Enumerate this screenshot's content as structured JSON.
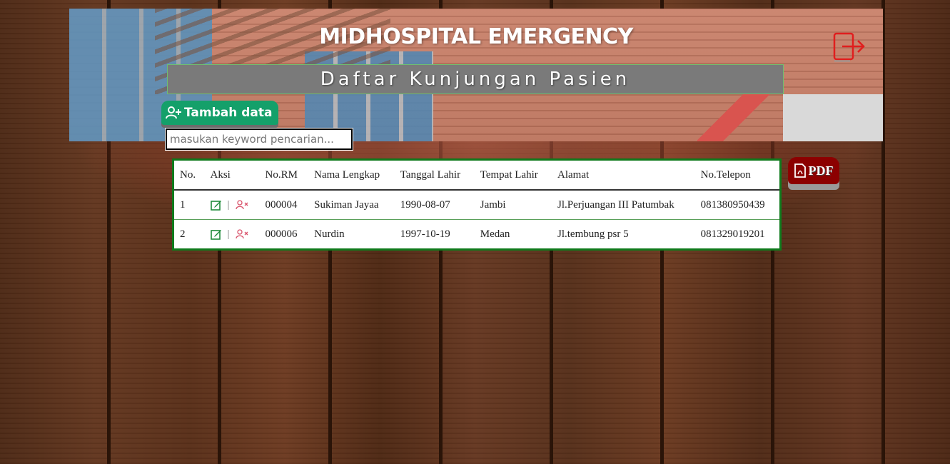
{
  "header": {
    "title": "MIDHOSPITAL EMERGENCY",
    "subtitle": "Daftar Kunjungan Pasien"
  },
  "actions": {
    "add_label": "Tambah data",
    "pdf_label": "PDF"
  },
  "search": {
    "placeholder": "masukan keyword pencarian..."
  },
  "table": {
    "columns": [
      "No.",
      "Aksi",
      "No.RM",
      "Nama Lengkap",
      "Tanggal Lahir",
      "Tempat Lahir",
      "Alamat",
      "No.Telepon"
    ],
    "rows": [
      {
        "no": "1",
        "rm": "000004",
        "nama": "Sukiman Jayaa",
        "tgl": "1990-08-07",
        "tempat": "Jambi",
        "alamat": "Jl.Perjuangan III Patumbak",
        "telp": "081380950439"
      },
      {
        "no": "2",
        "rm": "000006",
        "nama": "Nurdin",
        "tgl": "1997-10-19",
        "tempat": "Medan",
        "alamat": "Jl.tembung psr 5",
        "telp": "081329019201"
      }
    ],
    "separator": "|"
  },
  "colors": {
    "accent_green": "#14a06a",
    "table_border": "#0f7a1c",
    "pdf_red": "#8c0000",
    "logout_red": "#e01e1e"
  },
  "icons": {
    "logout": "logout-icon",
    "add_user": "user-plus-icon",
    "edit": "edit-icon",
    "delete": "user-x-icon",
    "pdf": "file-pdf-icon"
  }
}
